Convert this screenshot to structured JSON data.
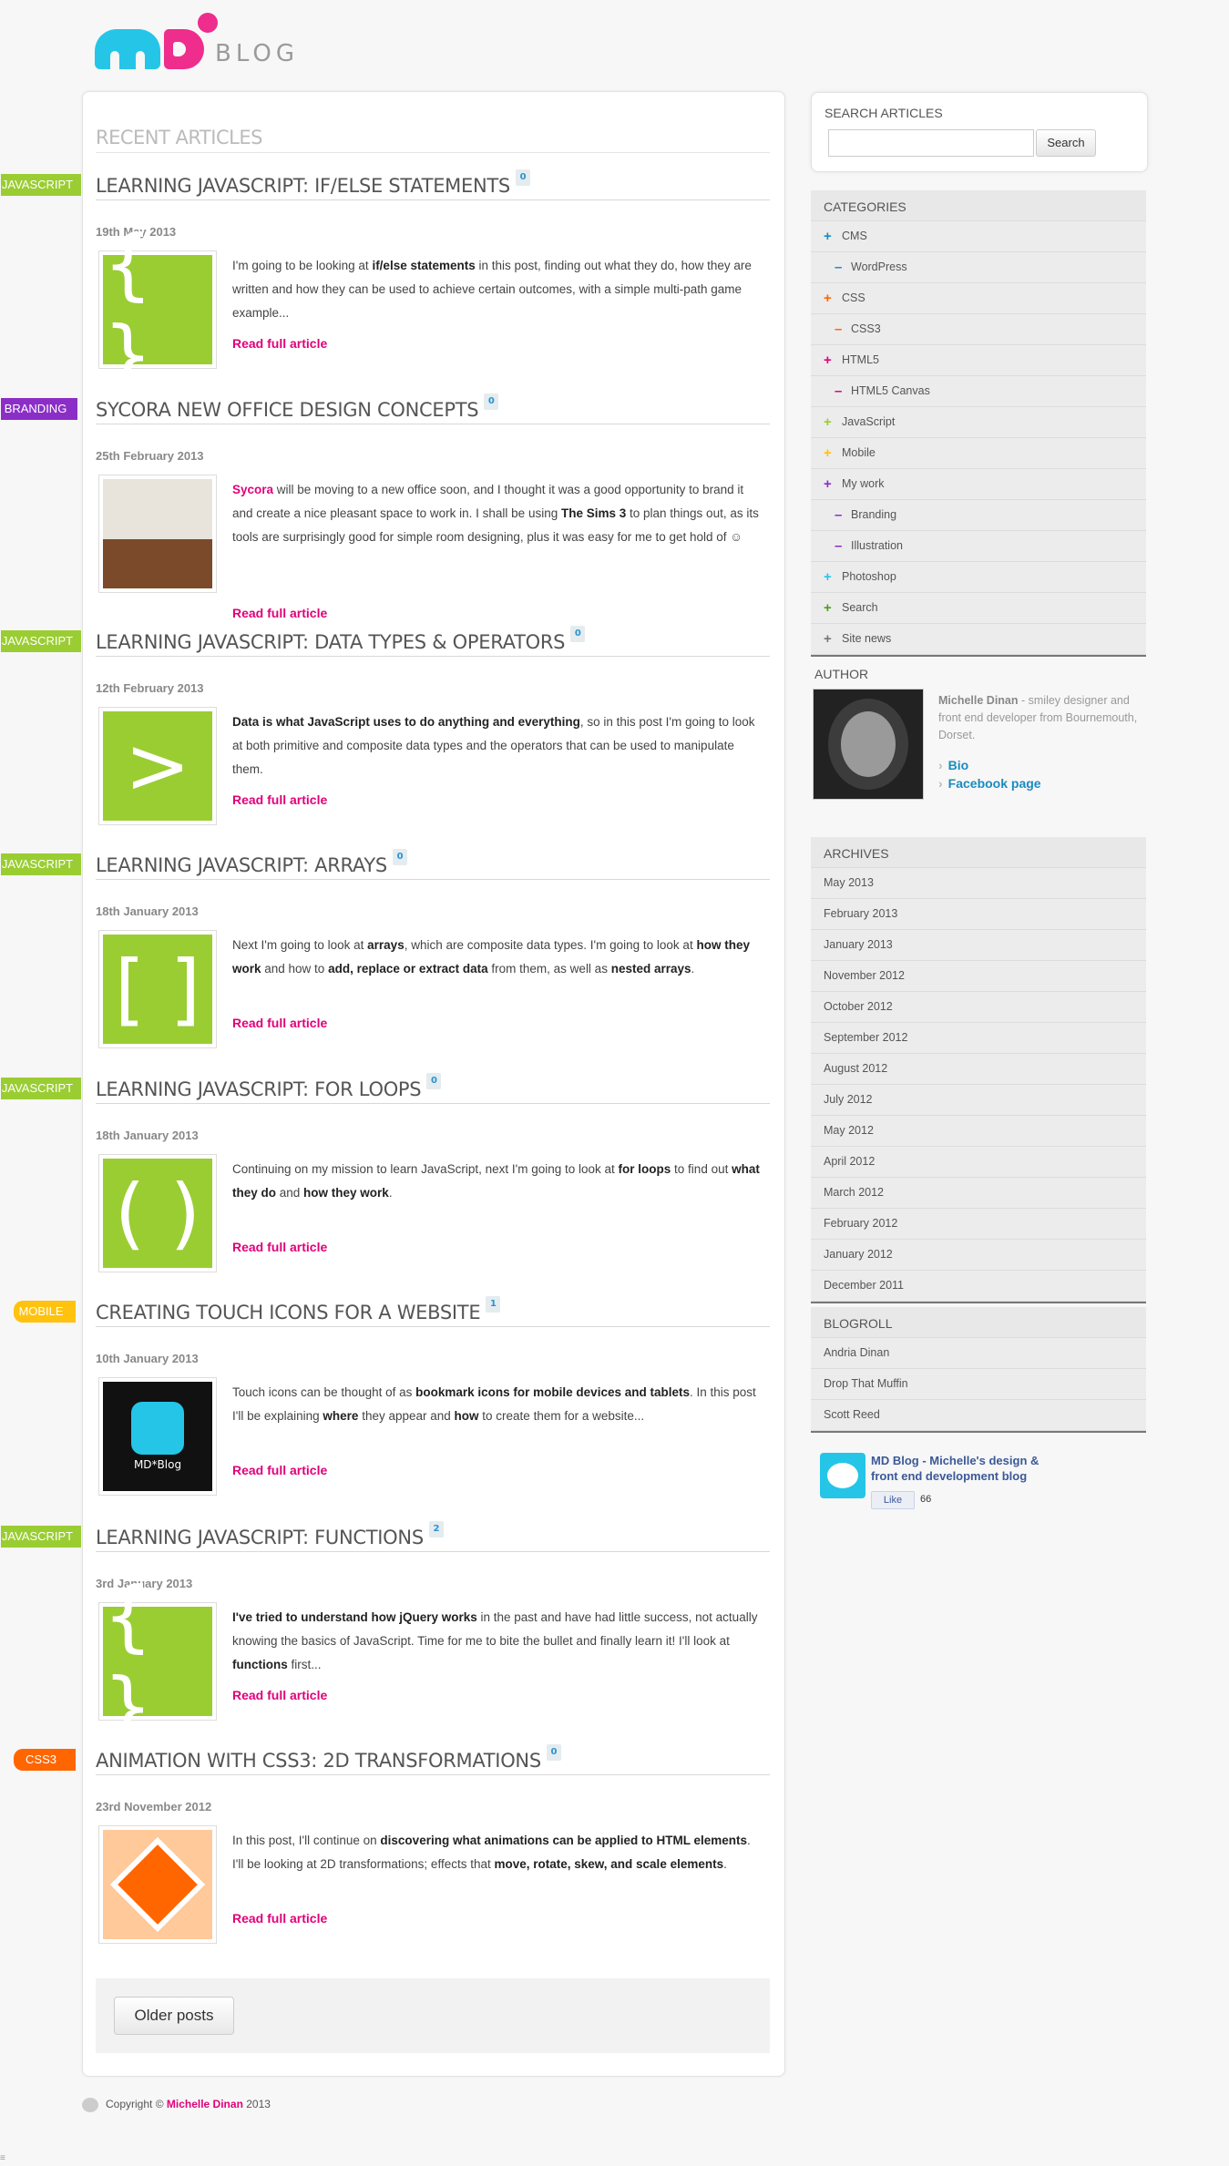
{
  "header": {
    "logo_text": "BLOG"
  },
  "main": {
    "heading": "RECENT ARTICLES",
    "read_more": "Read full article",
    "older_posts": "Older posts",
    "articles": [
      {
        "category": "JAVASCRIPT",
        "title": "LEARNING JAVASCRIPT: IF/ELSE STATEMENTS",
        "comments": "0",
        "date": "19th May 2013",
        "thumb": "{ }",
        "excerpt": [
          [
            "I'm going to be looking at ",
            false
          ],
          [
            "if/else statements",
            true
          ],
          [
            " in this post, finding out what they do, how they are written and how they can be used to achieve certain outcomes, with a simple multi-path game example...",
            false
          ]
        ]
      },
      {
        "category": "BRANDING",
        "title": "SYCORA NEW OFFICE DESIGN CONCEPTS",
        "comments": "0",
        "date": "25th February 2013",
        "thumb": "room",
        "excerpt": [
          [
            "Sycora",
            "link"
          ],
          [
            " will be moving to a new office soon, and I thought it was a good opportunity to brand it and create a nice pleasant space to work in. I shall be using ",
            false
          ],
          [
            "The Sims 3",
            true
          ],
          [
            " to plan things out, as its tools are surprisingly good for simple room designing, plus it was easy for me to get hold of ☺",
            false
          ]
        ]
      },
      {
        "category": "JAVASCRIPT",
        "title": "LEARNING JAVASCRIPT: DATA TYPES & OPERATORS",
        "comments": "0",
        "date": "12th February 2013",
        "thumb": ">",
        "excerpt": [
          [
            "Data is what JavaScript uses to do anything and everything",
            true
          ],
          [
            ", so in this post I'm going to look at both primitive and composite data types and the operators that can be used to manipulate them.",
            false
          ]
        ]
      },
      {
        "category": "JAVASCRIPT",
        "title": "LEARNING JAVASCRIPT: ARRAYS",
        "comments": "0",
        "date": "18th January 2013",
        "thumb": "[ ]",
        "excerpt": [
          [
            "Next I'm going to look at ",
            false
          ],
          [
            "arrays",
            true
          ],
          [
            ", which are composite data types. I'm going to look at ",
            false
          ],
          [
            "how they work",
            true
          ],
          [
            " and how to ",
            false
          ],
          [
            "add, replace or extract data",
            true
          ],
          [
            " from them, as well as ",
            false
          ],
          [
            "nested arrays",
            true
          ],
          [
            ".",
            false
          ]
        ]
      },
      {
        "category": "JAVASCRIPT",
        "title": "LEARNING JAVASCRIPT: FOR LOOPS",
        "comments": "0",
        "date": "18th January 2013",
        "thumb": "( )",
        "excerpt": [
          [
            "Continuing on my mission to learn JavaScript, next I'm going to look at ",
            false
          ],
          [
            "for loops",
            true
          ],
          [
            " to find out ",
            false
          ],
          [
            "what they do",
            true
          ],
          [
            " and ",
            false
          ],
          [
            "how they work",
            true
          ],
          [
            ".",
            false
          ]
        ]
      },
      {
        "category": "MOBILE",
        "title": "CREATING TOUCH ICONS FOR A WEBSITE",
        "comments": "1",
        "date": "10th January 2013",
        "thumb": "MD*Blog",
        "excerpt": [
          [
            "Touch icons can be thought of as ",
            false
          ],
          [
            "bookmark icons for mobile devices and tablets",
            true
          ],
          [
            ". In this post I'll be explaining ",
            false
          ],
          [
            "where",
            true
          ],
          [
            " they appear and ",
            false
          ],
          [
            "how",
            true
          ],
          [
            " to create them for a website...",
            false
          ]
        ]
      },
      {
        "category": "JAVASCRIPT",
        "title": "LEARNING JAVASCRIPT: FUNCTIONS",
        "comments": "2",
        "date": "3rd January 2013",
        "thumb": "{ }",
        "excerpt": [
          [
            "I've tried to understand how jQuery works",
            true
          ],
          [
            " in the past and have had little success, not actually knowing the basics of JavaScript. Time for me to bite the bullet and finally learn it! I'll look at ",
            false
          ],
          [
            "functions",
            true
          ],
          [
            " first...",
            false
          ]
        ]
      },
      {
        "category": "CSS3",
        "title": "ANIMATION WITH CSS3: 2D TRANSFORMATIONS",
        "comments": "0",
        "date": "23rd November 2012",
        "thumb": "css3",
        "excerpt": [
          [
            "In this post, I'll continue on ",
            false
          ],
          [
            "discovering what animations can be applied to HTML elements",
            true
          ],
          [
            ". I'll be looking at 2D transformations; effects that ",
            false
          ],
          [
            "move, rotate, skew, and scale elements",
            true
          ],
          [
            ".",
            false
          ]
        ]
      }
    ]
  },
  "sidebar": {
    "search": {
      "heading": "SEARCH ARTICLES",
      "button": "Search",
      "value": ""
    },
    "categories": {
      "heading": "CATEGORIES",
      "items": [
        {
          "label": "CMS",
          "sub": false,
          "color": "#1a8bc0"
        },
        {
          "label": "WordPress",
          "sub": true,
          "color": "#1a8bc0"
        },
        {
          "label": "CSS",
          "sub": false,
          "color": "#ff6600"
        },
        {
          "label": "CSS3",
          "sub": true,
          "color": "#ff6600"
        },
        {
          "label": "HTML5",
          "sub": false,
          "color": "#e1007a"
        },
        {
          "label": "HTML5 Canvas",
          "sub": true,
          "color": "#e1007a"
        },
        {
          "label": "JavaScript",
          "sub": false,
          "color": "#9acd32"
        },
        {
          "label": "Mobile",
          "sub": false,
          "color": "#ffc20e"
        },
        {
          "label": "My work",
          "sub": false,
          "color": "#8b2ec7"
        },
        {
          "label": "Branding",
          "sub": true,
          "color": "#8b2ec7"
        },
        {
          "label": "Illustration",
          "sub": true,
          "color": "#8b2ec7"
        },
        {
          "label": "Photoshop",
          "sub": false,
          "color": "#25c5e8"
        },
        {
          "label": "Search",
          "sub": false,
          "color": "#4a9e1e"
        },
        {
          "label": "Site news",
          "sub": false,
          "color": "#777777"
        }
      ]
    },
    "author": {
      "heading": "AUTHOR",
      "name": "Michelle Dinan",
      "bio": " - smiley designer and front end developer from Bournemouth, Dorset.",
      "links": [
        "Bio",
        "Facebook page"
      ]
    },
    "archives": {
      "heading": "ARCHIVES",
      "items": [
        "May 2013",
        "February 2013",
        "January 2013",
        "November 2012",
        "October 2012",
        "September 2012",
        "August 2012",
        "July 2012",
        "May 2012",
        "April 2012",
        "March 2012",
        "February 2012",
        "January 2012",
        "December 2011"
      ]
    },
    "blogroll": {
      "heading": "BLOGROLL",
      "items": [
        "Andria Dinan",
        "Drop That Muffin",
        "Scott Reed"
      ]
    },
    "facebook": {
      "title": "MD Blog - Michelle's design & front end development blog",
      "like": "Like",
      "count": "66"
    }
  },
  "footer": {
    "prefix": "Copyright © ",
    "name": "Michelle Dinan",
    "year": " 2013"
  },
  "colors": {
    "accent": "#e1007a",
    "javascript": "#9acd32",
    "branding": "#8b2ec7",
    "mobile": "#ffc20e",
    "css3": "#ff6600",
    "link": "#1a8bc0"
  }
}
